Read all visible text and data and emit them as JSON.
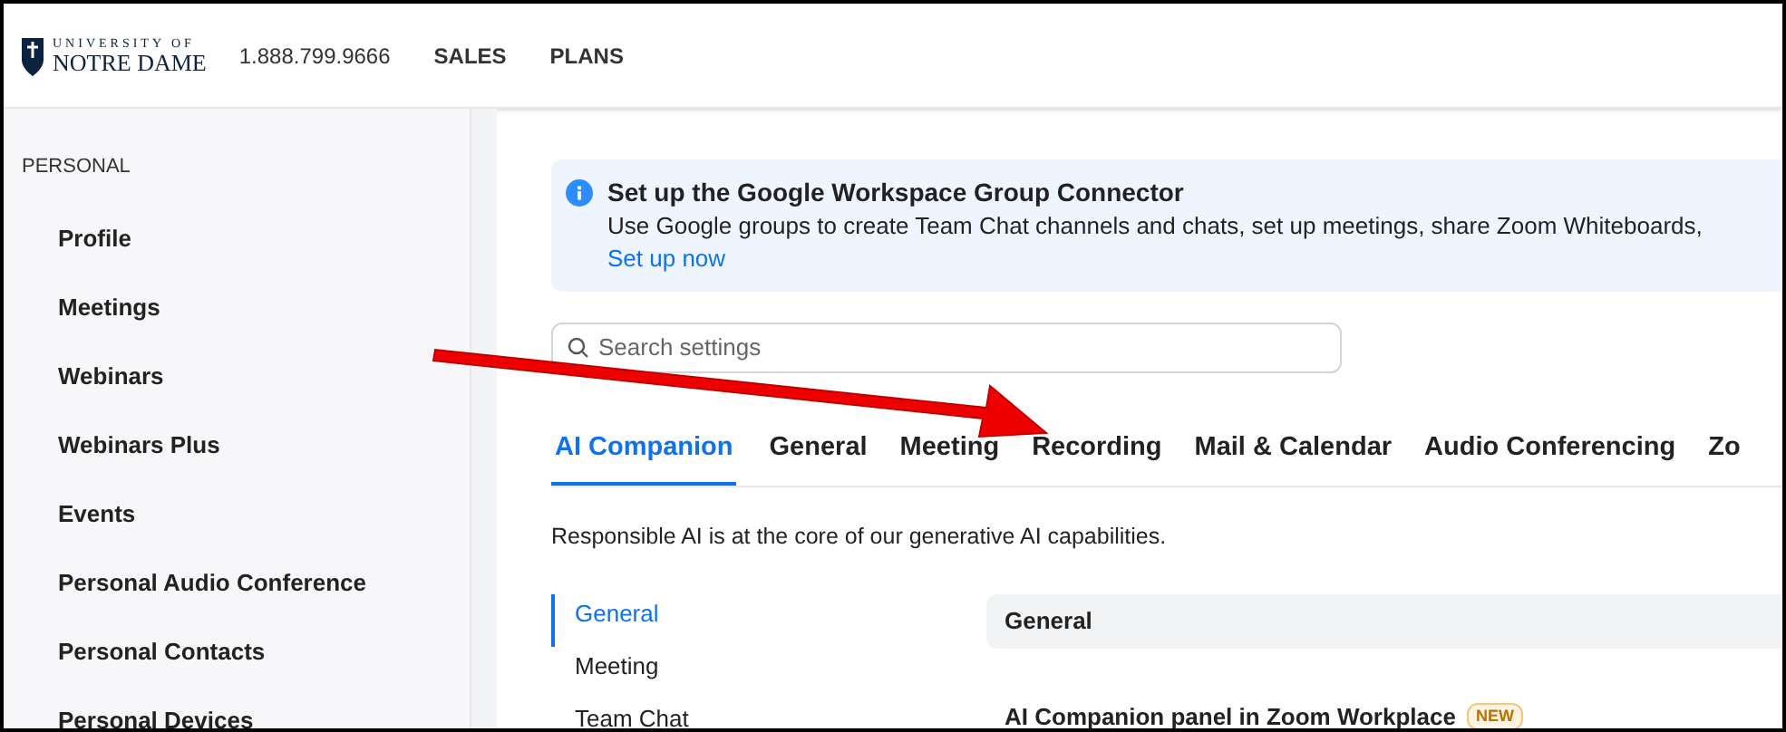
{
  "header": {
    "logo": {
      "line1": "UNIVERSITY OF",
      "line2": "NOTRE DAME"
    },
    "phone": "1.888.799.9666",
    "links": [
      "SALES",
      "PLANS"
    ]
  },
  "sidebar": {
    "section": "PERSONAL",
    "items": [
      {
        "label": "Profile"
      },
      {
        "label": "Meetings"
      },
      {
        "label": "Webinars"
      },
      {
        "label": "Webinars Plus"
      },
      {
        "label": "Events"
      },
      {
        "label": "Personal Audio Conference"
      },
      {
        "label": "Personal Contacts"
      },
      {
        "label": "Personal Devices"
      }
    ]
  },
  "banner": {
    "title": "Set up the Google Workspace Group Connector",
    "text": "Use Google groups to create Team Chat channels and chats, set up meetings, share Zoom Whiteboards,",
    "link": "Set up now"
  },
  "search": {
    "placeholder": "Search settings"
  },
  "tabs": [
    {
      "label": "AI Companion",
      "selected": true
    },
    {
      "label": "General",
      "selected": false
    },
    {
      "label": "Meeting",
      "selected": false
    },
    {
      "label": "Recording",
      "selected": false
    },
    {
      "label": "Mail & Calendar",
      "selected": false
    },
    {
      "label": "Audio Conferencing",
      "selected": false
    },
    {
      "label": "Zo",
      "selected": false
    }
  ],
  "intro": "Responsible AI is at the core of our generative AI capabilities.",
  "subnav": [
    {
      "label": "General",
      "selected": true
    },
    {
      "label": "Meeting",
      "selected": false
    },
    {
      "label": "Team Chat",
      "selected": false
    }
  ],
  "section": {
    "title": "General",
    "setting": "AI Companion panel in Zoom Workplace",
    "badge": "NEW"
  }
}
